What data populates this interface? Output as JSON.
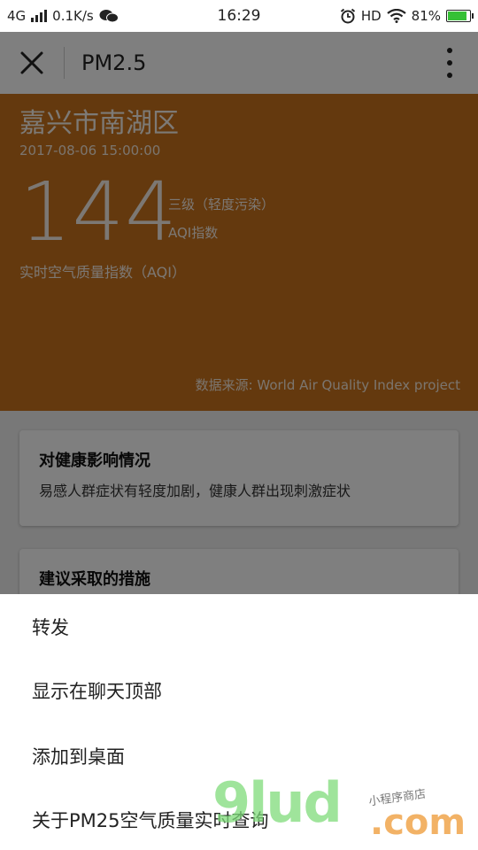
{
  "status_bar": {
    "network": "4G",
    "speed": "0.1K/s",
    "time": "16:29",
    "hd": "HD",
    "battery": "81%",
    "battery_level": 0.81
  },
  "nav": {
    "title": "PM2.5"
  },
  "hero": {
    "city": "嘉兴市南湖区",
    "timestamp": "2017-08-06 15:00:00",
    "aqi_value": "144",
    "aqi_level": "三级（轻度污染）",
    "aqi_unit": "AQI指数",
    "aqi_caption": "实时空气质量指数（AQI）",
    "source": "数据来源: World Air Quality Index project",
    "color": "#c8731d"
  },
  "cards": {
    "health_title": "对健康影响情况",
    "health_text": "易感人群症状有轻度加剧，健康人群出现刺激症状",
    "measure_title": "建议采取的措施"
  },
  "sheet": {
    "items": [
      "转发",
      "显示在聊天顶部",
      "添加到桌面",
      "关于PM25空气质量实时查询"
    ]
  },
  "watermark": {
    "big": "9lud",
    "com": ".com",
    "small": "小程序商店"
  }
}
